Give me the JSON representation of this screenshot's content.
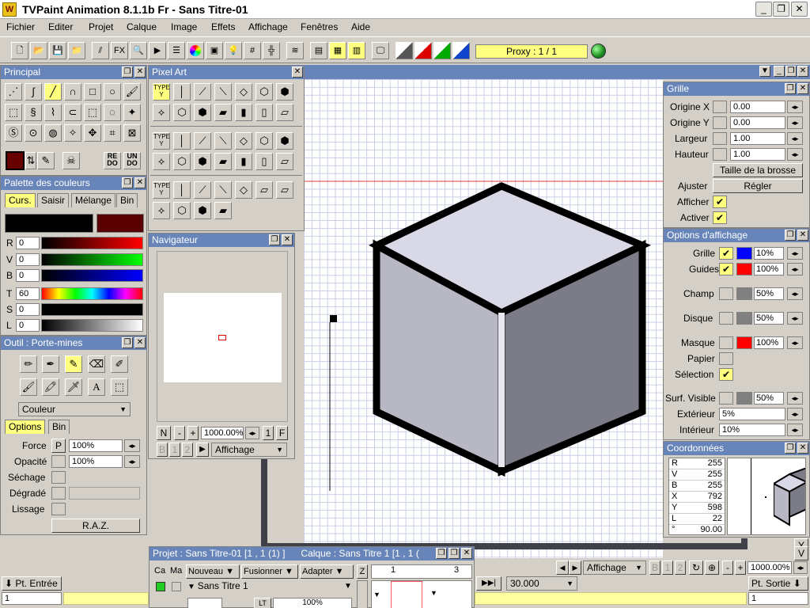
{
  "window": {
    "title": "TVPaint Animation 8.1.1b Fr - Sans Titre-01",
    "logo_text": "W",
    "minimize": "_",
    "maximize": "❐",
    "close": "✕"
  },
  "menu": [
    "Fichier",
    "Editer",
    "Projet",
    "Calque",
    "Image",
    "Effets",
    "Affichage",
    "Fenêtres",
    "Aide"
  ],
  "toolbar": {
    "proxy": "Proxy : 1 / 1",
    "fx_label": "FX"
  },
  "principal": {
    "title": "Principal",
    "redo": "RE DO",
    "undo": "UN DO"
  },
  "pixelart": {
    "title": "Pixel Art",
    "type_label": "TYPE"
  },
  "palette": {
    "title": "Palette des couleurs",
    "tabs": [
      "Curs.",
      "Saisir",
      "Mélange",
      "Bin"
    ],
    "sliders": [
      {
        "label": "R",
        "value": "0"
      },
      {
        "label": "V",
        "value": "0"
      },
      {
        "label": "B",
        "value": "0"
      },
      {
        "label": "T",
        "value": "60"
      },
      {
        "label": "S",
        "value": "0"
      },
      {
        "label": "L",
        "value": "0"
      }
    ]
  },
  "outil": {
    "title": "Outil : Porte-mines",
    "mode": "Couleur",
    "tabs": [
      "Options",
      "Bin"
    ],
    "force_label": "Force",
    "force_p": "P",
    "force_value": "100%",
    "opacite_label": "Opacité",
    "opacite_value": "100%",
    "sechage_label": "Séchage",
    "degrade_label": "Dégradé",
    "lissage_label": "Lissage",
    "raz": "R.A.Z.",
    "text_tool": "A"
  },
  "navigateur": {
    "title": "Navigateur",
    "n": "N",
    "minus": "-",
    "plus": "+",
    "zoom": "1000.00%",
    "one": "1",
    "f": "F",
    "display": "Affichage",
    "b1": "B",
    "b2": "1",
    "b3": "2"
  },
  "grille": {
    "title": "Grille",
    "origine_x_label": "Origine X",
    "origine_x": "0.00",
    "origine_y_label": "Origine Y",
    "origine_y": "0.00",
    "largeur_label": "Largeur",
    "largeur": "1.00",
    "hauteur_label": "Hauteur",
    "hauteur": "1.00",
    "taille": "Taille de la brosse",
    "ajuster_label": "Ajuster",
    "regler": "Régler",
    "afficher_label": "Afficher",
    "activer_label": "Activer",
    "check": "✔"
  },
  "affichage": {
    "title": "Options d'affichage",
    "rows": [
      {
        "label": "Grille",
        "pct": "10%"
      },
      {
        "label": "Guides",
        "pct": "100%"
      },
      {
        "label": "Champ",
        "pct": "50%"
      },
      {
        "label": "Disque",
        "pct": "50%"
      },
      {
        "label": "Masque",
        "pct": "100%"
      }
    ],
    "papier_label": "Papier",
    "selection_label": "Sélection",
    "surf_label": "Surf. Visible",
    "surf_pct": "50%",
    "exterieur_label": "Extérieur",
    "exterieur": "5%",
    "interieur_label": "Intérieur",
    "interieur": "10%",
    "colors": {
      "grille": "#0000ff",
      "guides": "#ff0000",
      "masque": "#ff0000",
      "gray": "#808080"
    }
  },
  "coords": {
    "title": "Coordonnées",
    "rows": [
      {
        "k": "R",
        "v": "255"
      },
      {
        "k": "V",
        "v": "255"
      },
      {
        "k": "B",
        "v": "255"
      },
      {
        "k": "X",
        "v": "792"
      },
      {
        "k": "Y",
        "v": "598"
      },
      {
        "k": "L",
        "v": "22"
      },
      {
        "k": "°",
        "v": "90.00"
      }
    ]
  },
  "projet": {
    "title": "Projet : Sans Titre-01 [1 , 1  (1) ]",
    "calque_title": "Calque : Sans Titre 1 [1 , 1  (",
    "col_ca": "Ca",
    "col_ma": "Ma",
    "nouveau": "Nouveau",
    "fusionner": "Fusionner",
    "adapter": "Adapter",
    "z": "Z",
    "layer": "Sans Titre 1",
    "frame1": "1",
    "frame3": "3",
    "lt": "LT",
    "layer_pct": "100%"
  },
  "timeline": {
    "pt_entree": "Pt. Entrée",
    "pt_sortie": "Pt. Sortie",
    "in_value": "1",
    "out_value": "1",
    "fps": "30.000",
    "affichage": "Affichage",
    "zoom": "1000.00%",
    "b1": "B",
    "b2": "1",
    "b3": "2",
    "y_btn": "Y",
    "v_btn": "V"
  }
}
